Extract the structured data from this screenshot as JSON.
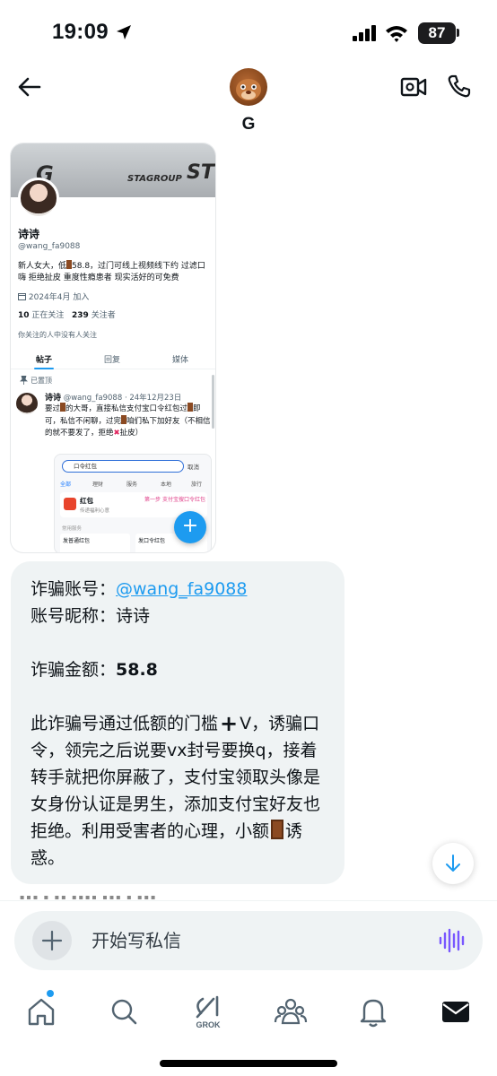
{
  "status_bar": {
    "time": "19:09",
    "battery": "87"
  },
  "header": {
    "contact_name": "G"
  },
  "shared_image": {
    "banner_text_1": "STAGROUP",
    "banner_text_2": "ST",
    "banner_text_3": "G",
    "profile_name": "诗诗",
    "profile_handle": "@wang_fa9088",
    "bio_1": "新人女大，低",
    "bio_2": "58.8，过门可线上视频线下约 过滤口嗨 拒绝扯皮 重度性瘾患者 现实活好的可免费",
    "joined": "2024年4月 加入",
    "following_count": "10",
    "following_label": "正在关注",
    "followers_count": "239",
    "followers_label": "关注者",
    "mutual_text": "你关注的人中没有人关注",
    "tabs": [
      "帖子",
      "回复",
      "媒体"
    ],
    "pinned_label": "已置顶",
    "post_name": "诗诗",
    "post_meta": "@wang_fa9088 · 24年12月23日",
    "post_1": "要过",
    "post_2": "的大哥，直接私信支付宝口令红包过",
    "post_3": "即可，私信不闲聊，过完",
    "post_4": "咱们私下加好友（不相信的就不要发了，拒绝",
    "post_5": "扯皮）",
    "embed_search": "口令红包",
    "embed_cancel": "取消",
    "embed_tabs": [
      "全部",
      "理财",
      "服务",
      "本地",
      "旅行"
    ],
    "embed_card_title": "红包",
    "embed_card_sub": "传递福利心意",
    "embed_step": "第一步 支付宝搜口令红包",
    "embed_common": "常用服务",
    "embed_cell_1": "发普通红包",
    "embed_cell_2": "发口令红包"
  },
  "message": {
    "account_label": "诈骗账号：",
    "account_handle": "@wang_fa9088",
    "nickname_label": "账号昵称：",
    "nickname": "诗诗",
    "amount_label": "诈骗金额：",
    "amount": "58.8",
    "body_1": "此诈骗号通过低额的门槛",
    "body_2": "V，诱骗口令，领完之后说要vx封号要换q，接着转手就把你屏蔽了，支付宝领取头像是女身份认证是男生，添加支付宝好友也拒绝。利用受害者的心理，小额",
    "body_3": "诱惑。"
  },
  "composer": {
    "placeholder": "开始写私信"
  },
  "tab_bar": {
    "grok_label": "GROK"
  },
  "colors": {
    "accent": "#1d9bf0",
    "bubble": "#eff3f4",
    "voice": "#7856ff"
  }
}
